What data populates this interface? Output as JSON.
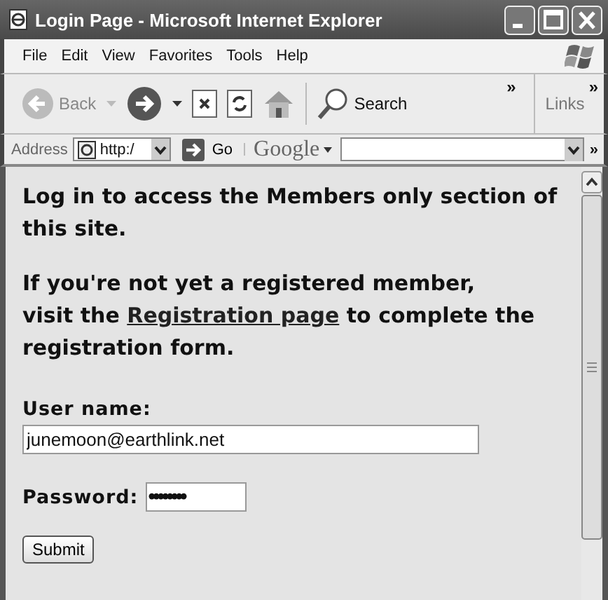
{
  "window": {
    "title": "Login Page - Microsoft Internet Explorer"
  },
  "menu": [
    "File",
    "Edit",
    "View",
    "Favorites",
    "Tools",
    "Help"
  ],
  "toolbar": {
    "back": {
      "label": "Back",
      "disabled": true
    },
    "search": "Search",
    "overflow": "»",
    "links": "Links",
    "links_overflow": "»"
  },
  "address_bar": {
    "label": "Address",
    "url": "http:/",
    "go": "Go",
    "google": "Google",
    "overflow": "»"
  },
  "page": {
    "intro": "Log in to access the Members only section of this site.",
    "register_before": "If you're not yet a registered member,",
    "register_visit": "visit the",
    "register_link": "Registration page",
    "register_after": "to complete the registration form.",
    "fields": [
      {
        "label": "User name:",
        "value": "junemoon@earthlink.net",
        "kind": "text"
      },
      {
        "label": "Password:",
        "value": "••••••••",
        "kind": "password"
      }
    ],
    "submit": "Submit"
  }
}
